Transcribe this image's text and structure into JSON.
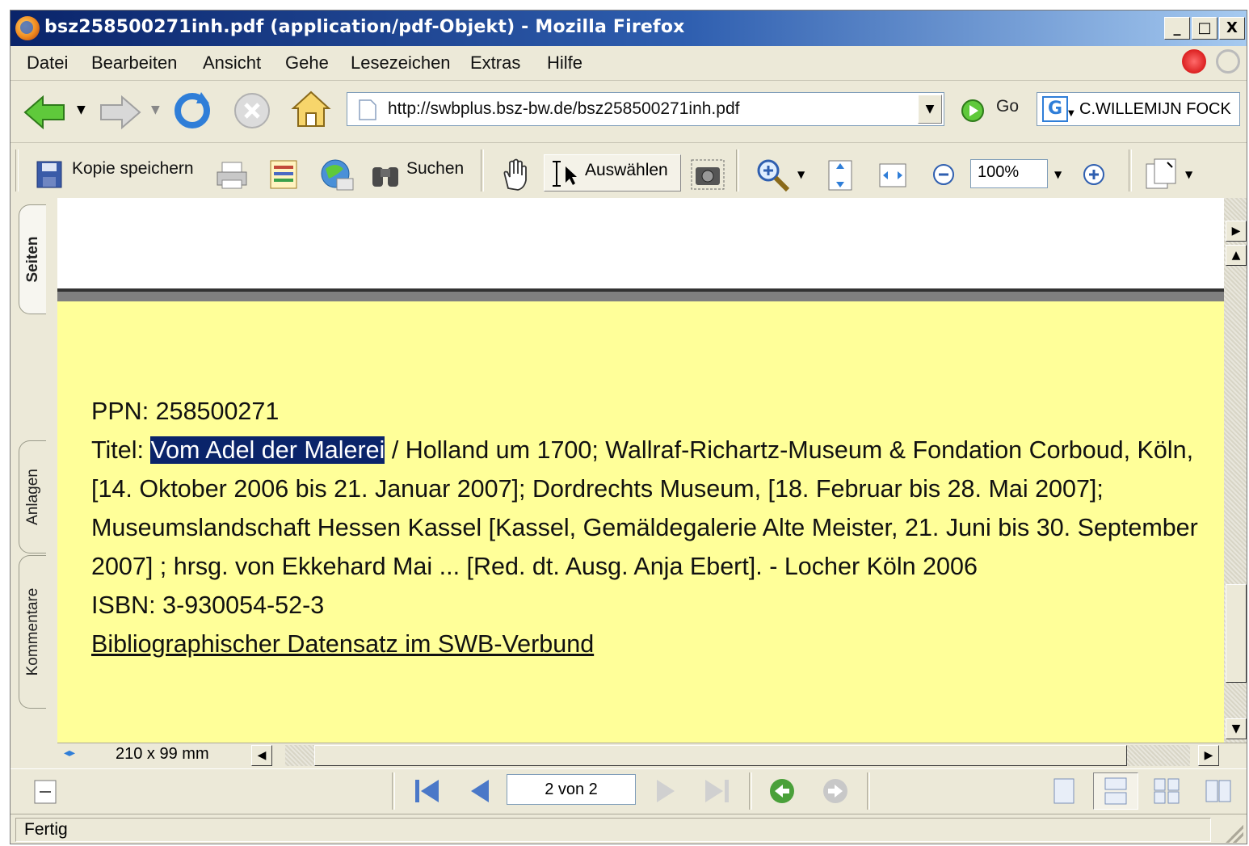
{
  "window": {
    "title": "bsz258500271inh.pdf (application/pdf-Objekt) - Mozilla Firefox",
    "controls": [
      "_",
      "□",
      "X"
    ]
  },
  "menubar": [
    "Datei",
    "Bearbeiten",
    "Ansicht",
    "Gehe",
    "Lesezeichen",
    "Extras",
    "Hilfe"
  ],
  "navbar": {
    "url": "http://swbplus.bsz-bw.de/bsz258500271inh.pdf",
    "go_label": "Go",
    "search_value": "C.WILLEMIJN FOCK"
  },
  "pdf_toolbar": {
    "save_label": "Kopie speichern",
    "search_label": "Suchen",
    "select_label": "Auswählen",
    "zoom_value": "100%"
  },
  "side_tabs": {
    "pages": "Seiten",
    "attachments": "Anlagen",
    "comments": "Kommentare"
  },
  "document": {
    "ppn": "PPN: 258500271",
    "title_prefix": "Titel: ",
    "title_selected": "Vom Adel der Malerei",
    "title_rest": " / Holland um 1700; Wallraf-Richartz-Museum & Fondation Corboud, Köln, [14. Oktober 2006 bis 21. Januar 2007]; Dordrechts Museum, [18. Februar bis 28. Mai 2007]; Museumslandschaft Hessen Kassel [Kassel, Gemäldegalerie Alte Meister, 21. Juni bis 30. September 2007] ; hrsg. von Ekkehard Mai ... [Red. dt. Ausg. Anja Ebert]. - Locher Köln 2006",
    "isbn": "ISBN: 3-930054-52-3",
    "link": "Bibliographischer Datensatz im SWB-Verbund"
  },
  "page_size": "210 x 99 mm",
  "page_indicator": "2 von 2",
  "status": "Fertig",
  "colors": {
    "page_background": "#ffff99",
    "selection": "#0a246a",
    "chrome": "#ece9d8"
  }
}
